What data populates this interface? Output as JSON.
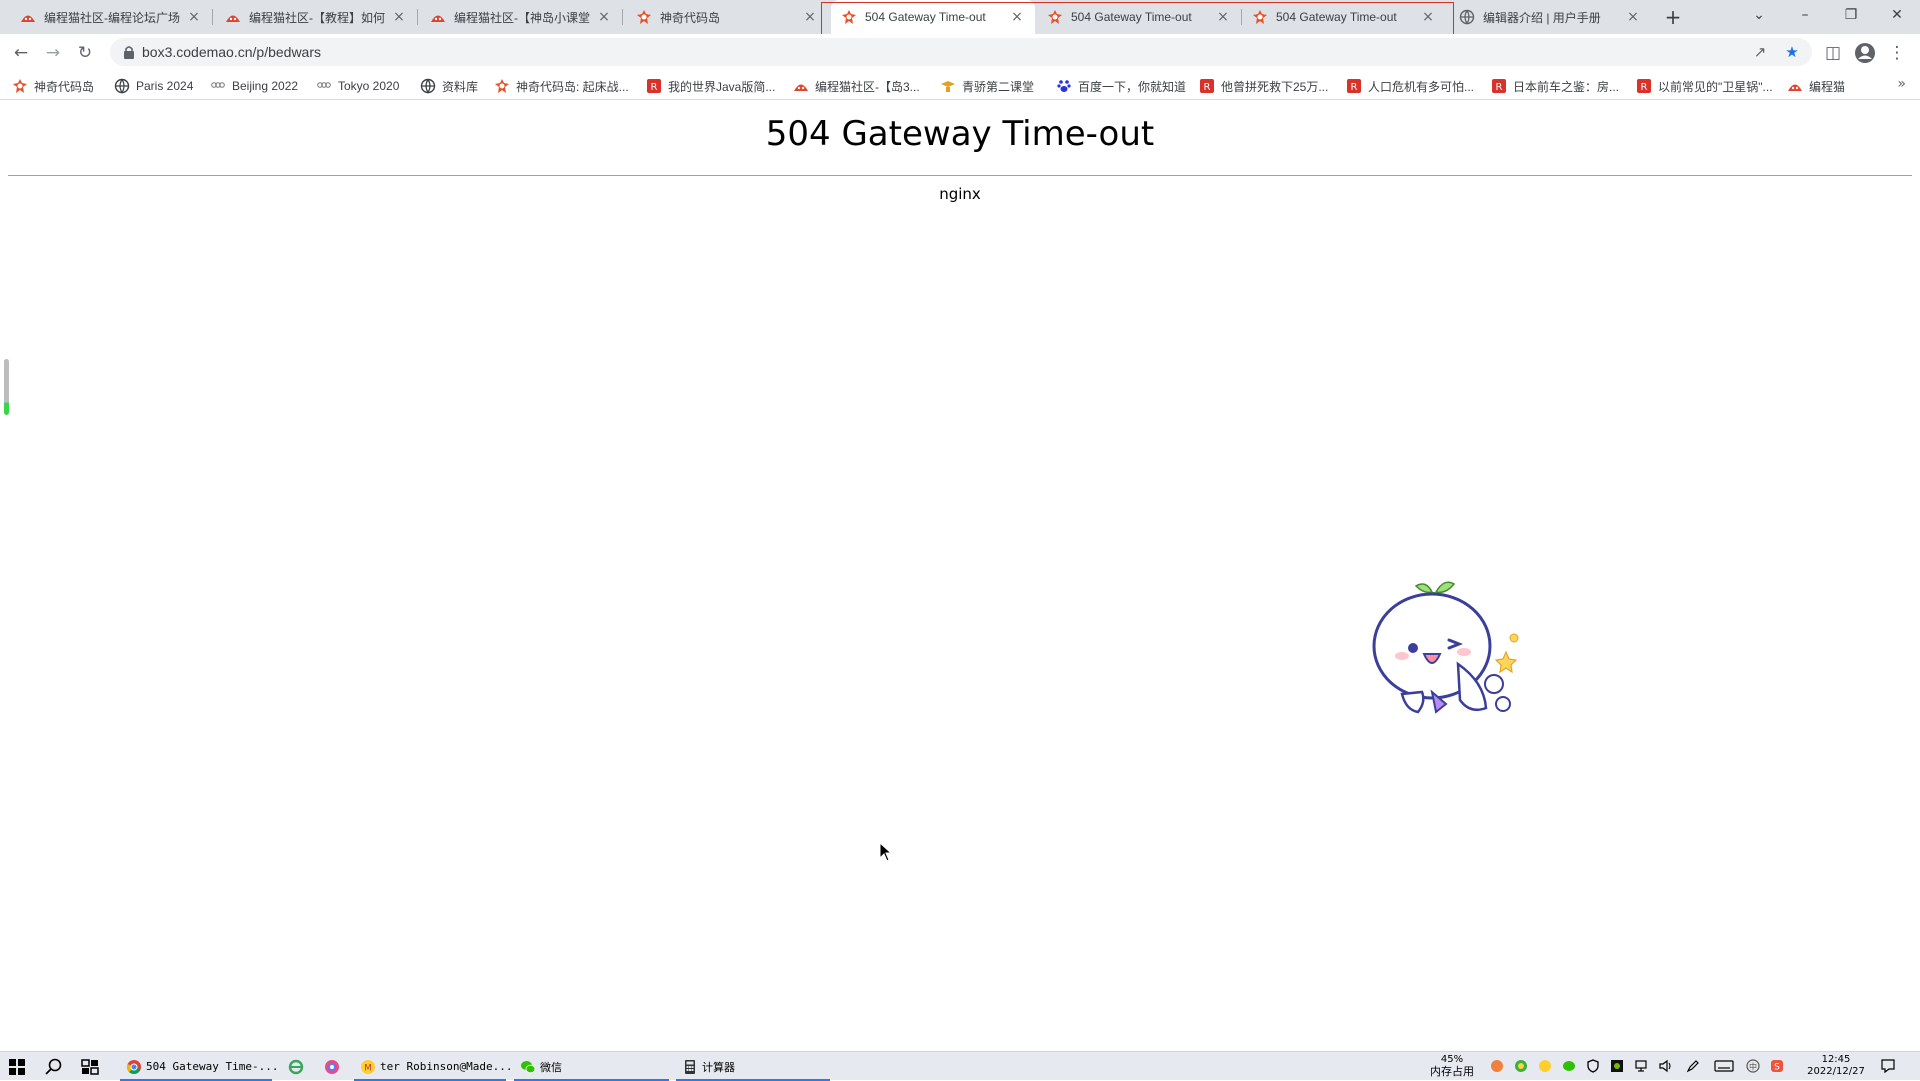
{
  "browser": {
    "tabs": [
      {
        "title": "编程猫社区-编程论坛广场",
        "icon": "codemao-cat-icon"
      },
      {
        "title": "编程猫社区-【教程】如何",
        "icon": "codemao-cat-icon"
      },
      {
        "title": "编程猫社区-【神岛小课堂",
        "icon": "codemao-cat-icon"
      },
      {
        "title": "神奇代码岛",
        "icon": "box3-icon"
      },
      {
        "title": "504 Gateway Time-out",
        "icon": "box3-icon"
      },
      {
        "title": "504 Gateway Time-out",
        "icon": "box3-icon"
      },
      {
        "title": "504 Gateway Time-out",
        "icon": "box3-icon"
      },
      {
        "title": "编辑器介绍 | 用户手册",
        "icon": "globe-icon"
      }
    ],
    "close_glyph": "×",
    "new_tab_glyph": "+",
    "url": "box3.codemao.cn/p/bedwars",
    "bookmarks": [
      {
        "label": "神奇代码岛",
        "icon": "box3-icon"
      },
      {
        "label": "Paris 2024",
        "icon": "globe-icon"
      },
      {
        "label": "Beijing 2022",
        "icon": "olympic-rings-icon"
      },
      {
        "label": "Tokyo 2020",
        "icon": "olympic-rings-icon"
      },
      {
        "label": "资料库",
        "icon": "globe-icon"
      },
      {
        "label": "神奇代码岛: 起床战...",
        "icon": "box3-icon"
      },
      {
        "label": "我的世界Java版简...",
        "icon": "red-square-icon"
      },
      {
        "label": "编程猫社区-【岛3...",
        "icon": "codemao-cat-icon"
      },
      {
        "label": "青骄第二课堂",
        "icon": "graduation-icon"
      },
      {
        "label": "百度一下，你就知道",
        "icon": "baidu-paw-icon"
      },
      {
        "label": "他曾拼死救下25万...",
        "icon": "red-square-icon"
      },
      {
        "label": "人口危机有多可怕...",
        "icon": "red-square-icon"
      },
      {
        "label": "日本前车之鉴：房...",
        "icon": "red-square-icon"
      },
      {
        "label": "以前常见的\"卫星锅\"...",
        "icon": "red-square-icon"
      },
      {
        "label": "编程猫",
        "icon": "codemao-cat-icon"
      }
    ],
    "bookmarks_overflow": "»"
  },
  "page": {
    "title": "504 Gateway Time-out",
    "server": "nginx"
  },
  "taskbar": {
    "apps": [
      {
        "label": "504 Gateway Time-...",
        "icon": "chrome-icon"
      },
      {
        "label": "ter Robinson@Made...",
        "icon": "music-player-icon"
      },
      {
        "label": "微信",
        "icon": "wechat-icon"
      },
      {
        "label": "计算器",
        "icon": "calculator-icon"
      }
    ],
    "memory_percent": "45%",
    "memory_label": "内存占用",
    "time": "12:45",
    "date": "2022/12/27"
  },
  "colors": {
    "tab_group_outline": "#d93025",
    "bookmark_star": "#1a73e8",
    "taskbar_accent": "#2f7ae5"
  }
}
